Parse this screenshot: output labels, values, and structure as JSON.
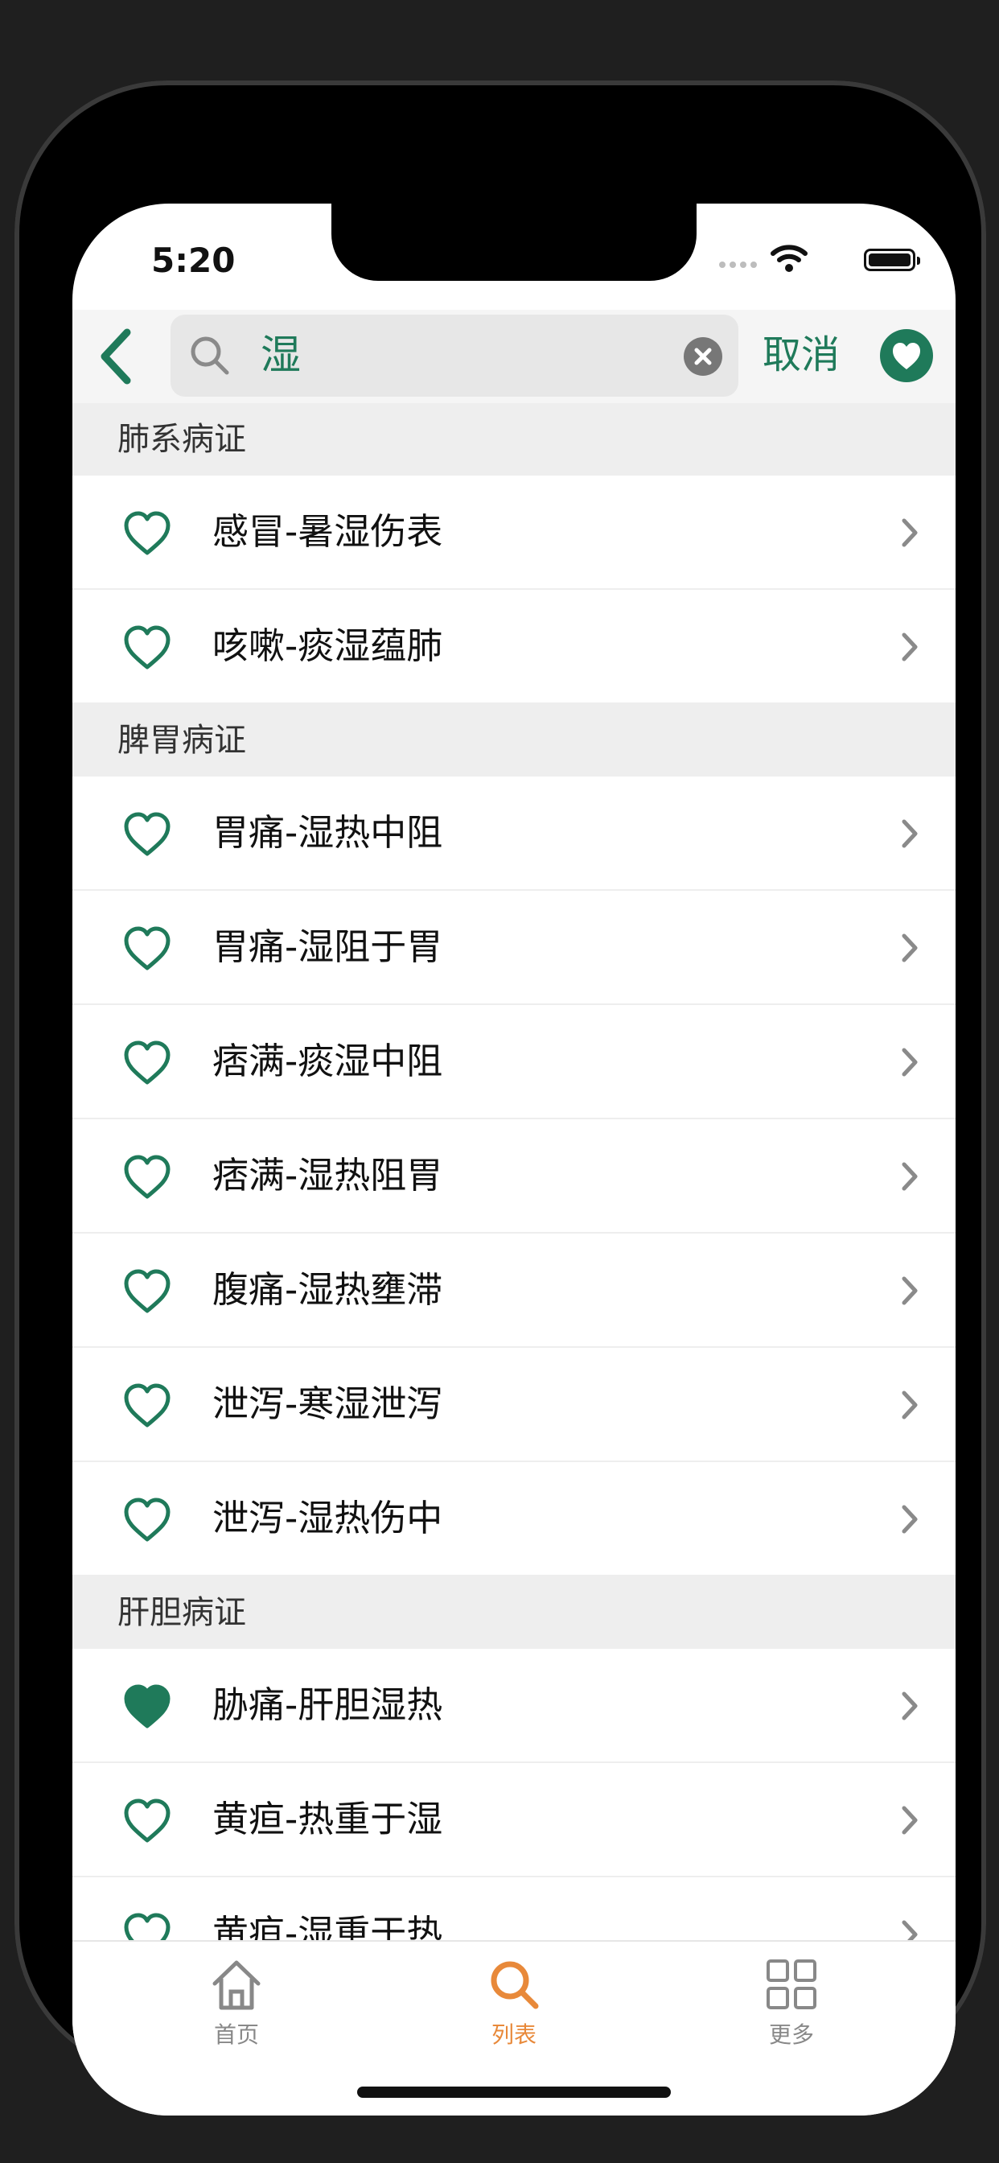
{
  "status_bar": {
    "time": "5:20"
  },
  "search": {
    "value": "湿",
    "cancel_label": "取消"
  },
  "colors": {
    "accent": "#1f7a5a",
    "tab_active": "#e8893a",
    "tab_inactive": "#888888"
  },
  "sections": [
    {
      "header": "肺系病证",
      "items": [
        {
          "label": "感冒-暑湿伤表",
          "favorite": false
        },
        {
          "label": "咳嗽-痰湿蕴肺",
          "favorite": false
        }
      ]
    },
    {
      "header": "脾胃病证",
      "items": [
        {
          "label": "胃痛-湿热中阻",
          "favorite": false
        },
        {
          "label": "胃痛-湿阻于胃",
          "favorite": false
        },
        {
          "label": "痞满-痰湿中阻",
          "favorite": false
        },
        {
          "label": "痞满-湿热阻胃",
          "favorite": false
        },
        {
          "label": "腹痛-湿热壅滞",
          "favorite": false
        },
        {
          "label": "泄泻-寒湿泄泻",
          "favorite": false
        },
        {
          "label": "泄泻-湿热伤中",
          "favorite": false
        }
      ]
    },
    {
      "header": "肝胆病证",
      "items": [
        {
          "label": "胁痛-肝胆湿热",
          "favorite": true
        },
        {
          "label": "黄疸-热重于湿",
          "favorite": false
        },
        {
          "label": "黄疸-湿重于热",
          "favorite": false
        }
      ]
    }
  ],
  "tabs": [
    {
      "label": "首页",
      "icon": "home-icon",
      "active": false
    },
    {
      "label": "列表",
      "icon": "search-icon",
      "active": true
    },
    {
      "label": "更多",
      "icon": "grid-icon",
      "active": false
    }
  ]
}
